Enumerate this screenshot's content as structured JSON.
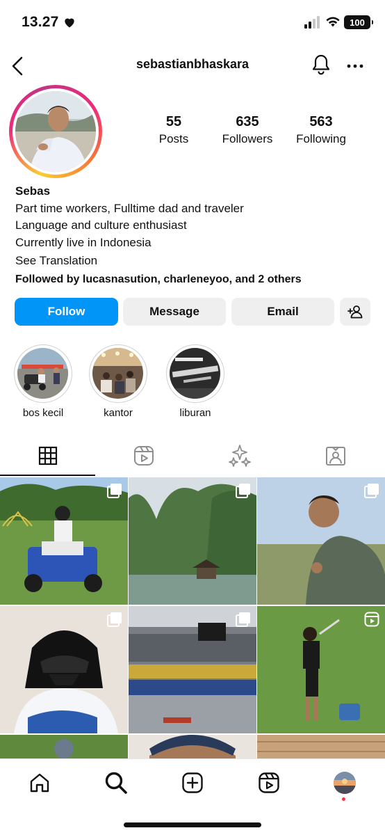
{
  "status_bar": {
    "time": "13.27",
    "battery": "100"
  },
  "header": {
    "username": "sebastianbhaskara"
  },
  "stats": [
    {
      "value": "55",
      "label": "Posts"
    },
    {
      "value": "635",
      "label": "Followers"
    },
    {
      "value": "563",
      "label": "Following"
    }
  ],
  "bio": {
    "name": "Sebas",
    "lines": [
      "Part time workers, Fulltime dad and traveler",
      "Language and culture enthusiast",
      "Currently live in Indonesia"
    ],
    "see_translation": "See Translation",
    "followed_by": "Followed by lucasnasution, charleneyoo, and 2 others"
  },
  "actions": {
    "follow": "Follow",
    "message": "Message",
    "email": "Email"
  },
  "highlights": [
    {
      "label": "bos kecil"
    },
    {
      "label": "kantor"
    },
    {
      "label": "liburan"
    }
  ],
  "tabs": [
    "grid-icon",
    "reels-icon",
    "sparkles-icon",
    "tagged-icon"
  ],
  "nav": [
    "home-icon",
    "search-icon",
    "create-icon",
    "reels-icon",
    "profile-avatar"
  ],
  "colors": {
    "follow_blue": "#0095f6",
    "button_gray": "#efefef",
    "notification_dot": "#ff3040"
  }
}
